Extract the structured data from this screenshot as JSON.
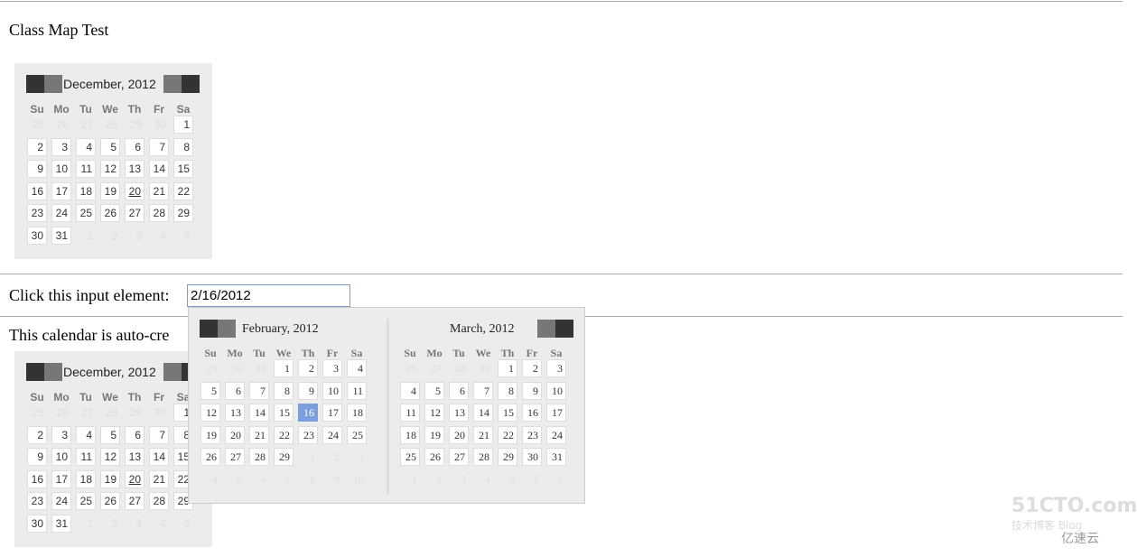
{
  "heading": "Class Map Test",
  "input_label": "Click this input element:",
  "input_value": "2/16/2012",
  "auto_text": "This calendar is auto-cre",
  "day_names": [
    "Su",
    "Mo",
    "Tu",
    "We",
    "Th",
    "Fr",
    "Sa"
  ],
  "calendar1": {
    "title": "December, 2012",
    "today": 20,
    "weeks": [
      [
        25,
        26,
        27,
        28,
        29,
        30,
        1
      ],
      [
        2,
        3,
        4,
        5,
        6,
        7,
        8
      ],
      [
        9,
        10,
        11,
        12,
        13,
        14,
        15
      ],
      [
        16,
        17,
        18,
        19,
        20,
        21,
        22
      ],
      [
        23,
        24,
        25,
        26,
        27,
        28,
        29
      ],
      [
        30,
        31,
        1,
        2,
        3,
        4,
        5
      ]
    ]
  },
  "calendar2": {
    "title": "December, 2012",
    "today": 20,
    "weeks": [
      [
        25,
        26,
        27,
        28,
        29,
        30,
        1
      ],
      [
        2,
        3,
        4,
        5,
        6,
        7,
        8
      ],
      [
        9,
        10,
        11,
        12,
        13,
        14,
        15
      ],
      [
        16,
        17,
        18,
        19,
        20,
        21,
        22
      ],
      [
        23,
        24,
        25,
        26,
        27,
        28,
        29
      ],
      [
        30,
        31,
        1,
        2,
        3,
        4,
        5
      ]
    ]
  },
  "popup": {
    "months": [
      {
        "title": "February, 2012",
        "selected": 16,
        "weeks": [
          [
            29,
            30,
            31,
            1,
            2,
            3,
            4
          ],
          [
            5,
            6,
            7,
            8,
            9,
            10,
            11
          ],
          [
            12,
            13,
            14,
            15,
            16,
            17,
            18
          ],
          [
            19,
            20,
            21,
            22,
            23,
            24,
            25
          ],
          [
            26,
            27,
            28,
            29,
            1,
            2,
            3
          ],
          [
            4,
            5,
            6,
            7,
            8,
            9,
            10
          ]
        ]
      },
      {
        "title": "March, 2012",
        "weeks": [
          [
            26,
            27,
            28,
            29,
            1,
            2,
            3
          ],
          [
            4,
            5,
            6,
            7,
            8,
            9,
            10
          ],
          [
            11,
            12,
            13,
            14,
            15,
            16,
            17
          ],
          [
            18,
            19,
            20,
            21,
            22,
            23,
            24
          ],
          [
            25,
            26,
            27,
            28,
            29,
            30,
            31
          ],
          [
            1,
            2,
            3,
            4,
            5,
            6,
            7
          ]
        ]
      }
    ]
  },
  "watermark": {
    "line1": "51CTO.com",
    "line2": "技术博客 Blog",
    "brand": "亿速云"
  },
  "colors": {
    "selected": "#7b9fdc",
    "nav_dark": "#333333",
    "nav_light": "#777777",
    "calendar_bg": "#ececec"
  }
}
